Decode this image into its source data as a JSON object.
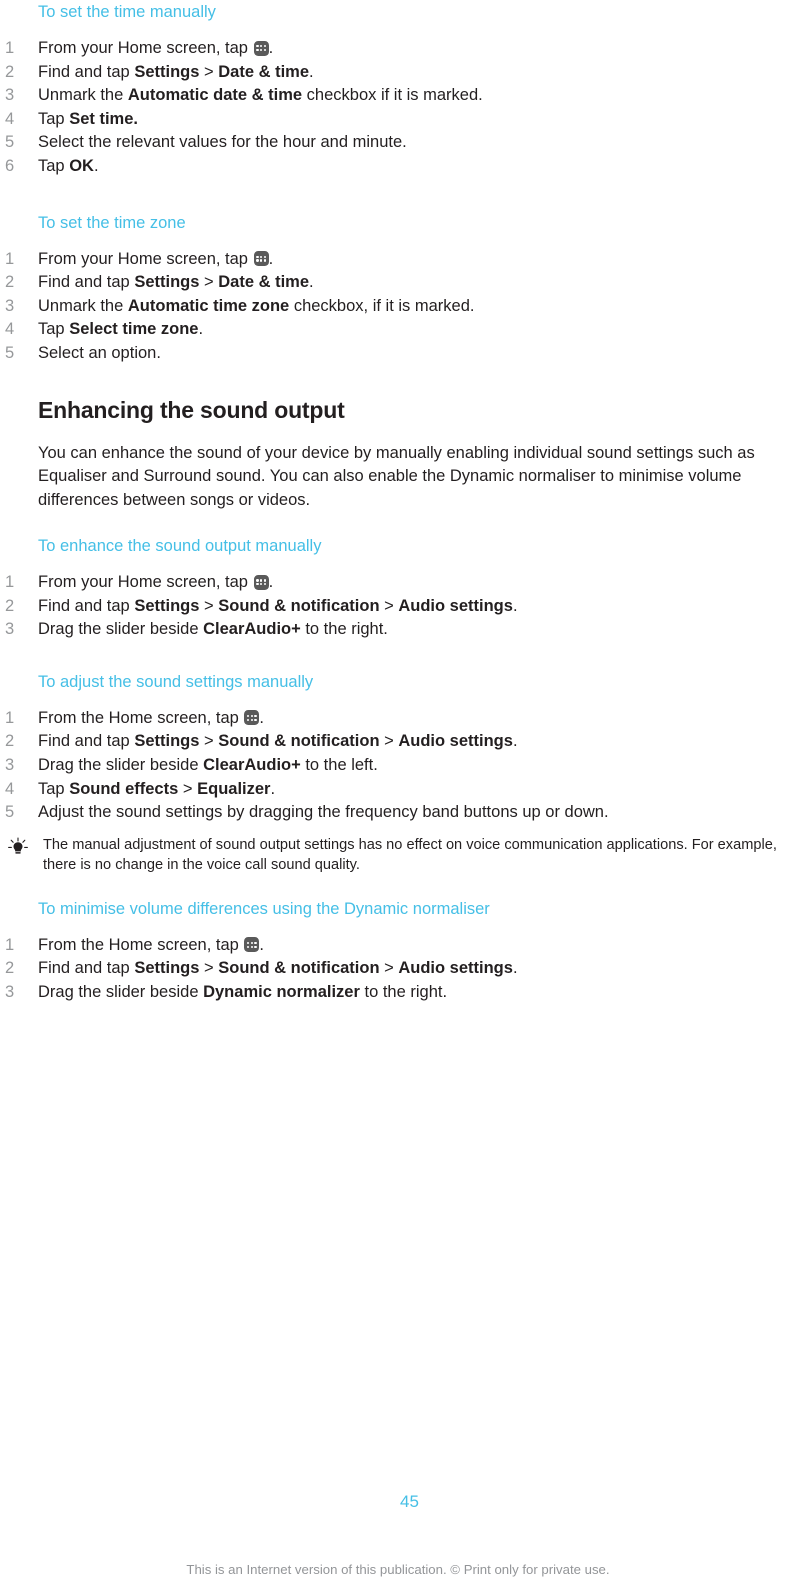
{
  "document": {
    "page_number": "45",
    "footer_note": "This is an Internet version of this publication. © Print only for private use.",
    "accent_color": "#45bfe6",
    "text_color": "#231f20",
    "number_color": "#96989a",
    "footer_color": "#939598"
  },
  "procedures": {
    "set_time_manually": {
      "title": "To set the time manually",
      "steps": [
        {
          "pre": "From your Home screen, tap ",
          "icon": "app-drawer-icon",
          "post": "."
        },
        {
          "pre": "Find and tap ",
          "bold1": "Settings",
          "sep1": " > ",
          "bold2": "Date & time",
          "post": "."
        },
        {
          "pre": "Unmark the ",
          "bold1": "Automatic date & time",
          "post": " checkbox if it is marked."
        },
        {
          "pre": "Tap ",
          "bold1": "Set time.",
          "post": ""
        },
        {
          "pre": "Select the relevant values for the hour and minute.",
          "post": ""
        },
        {
          "pre": "Tap ",
          "bold1": "OK",
          "post": "."
        }
      ]
    },
    "set_time_zone": {
      "title": "To set the time zone",
      "steps": [
        {
          "pre": "From your Home screen, tap ",
          "icon": "app-drawer-icon",
          "post": "."
        },
        {
          "pre": "Find and tap ",
          "bold1": "Settings",
          "sep1": " > ",
          "bold2": "Date & time",
          "post": "."
        },
        {
          "pre": "Unmark the ",
          "bold1": "Automatic time zone",
          "post": " checkbox, if it is marked."
        },
        {
          "pre": "Tap ",
          "bold1": "Select time zone",
          "post": "."
        },
        {
          "pre": "Select an option.",
          "post": ""
        }
      ]
    },
    "enhance_sound_output_manually": {
      "title": "To enhance the sound output manually",
      "steps": [
        {
          "pre": "From your Home screen, tap ",
          "icon": "app-drawer-icon",
          "post": "."
        },
        {
          "pre": "Find and tap ",
          "bold1": "Settings",
          "sep1": " > ",
          "bold2": "Sound & notification",
          "sep2": " > ",
          "bold3": "Audio settings",
          "post": "."
        },
        {
          "pre": "Drag the slider beside ",
          "bold1": "ClearAudio+",
          "post": " to the right."
        }
      ]
    },
    "adjust_sound_settings_manually": {
      "title": "To adjust the sound settings manually",
      "steps": [
        {
          "pre": "From the Home screen, tap ",
          "icon": "app-drawer-icon",
          "post": "."
        },
        {
          "pre": "Find and tap ",
          "bold1": "Settings",
          "sep1": " > ",
          "bold2": "Sound & notification",
          "sep2": " > ",
          "bold3": "Audio settings",
          "post": "."
        },
        {
          "pre": "Drag the slider beside ",
          "bold1": "ClearAudio+",
          "post": " to the left."
        },
        {
          "pre": "Tap ",
          "bold1": "Sound effects",
          "sep1": " > ",
          "bold2": "Equalizer",
          "post": "."
        },
        {
          "pre": "Adjust the sound settings by dragging the frequency band buttons up or down.",
          "post": ""
        }
      ]
    },
    "minimise_volume_differences": {
      "title": "To minimise volume differences using the Dynamic normaliser",
      "steps": [
        {
          "pre": "From the Home screen, tap ",
          "icon": "app-drawer-icon",
          "post": "."
        },
        {
          "pre": "Find and tap ",
          "bold1": "Settings",
          "sep1": " > ",
          "bold2": "Sound & notification",
          "sep2": " > ",
          "bold3": "Audio settings",
          "post": "."
        },
        {
          "pre": "Drag the slider beside ",
          "bold1": "Dynamic normalizer",
          "post": " to the right."
        }
      ]
    }
  },
  "section": {
    "heading": "Enhancing the sound output",
    "intro": "You can enhance the sound of your device by manually enabling individual sound settings such as Equaliser and Surround sound. You can also enable the Dynamic normaliser to minimise volume differences between songs or videos."
  },
  "tip": {
    "icon": "lightbulb-tip-icon",
    "text": "The manual adjustment of sound output settings has no effect on voice communication applications. For example, there is no change in the voice call sound quality."
  }
}
